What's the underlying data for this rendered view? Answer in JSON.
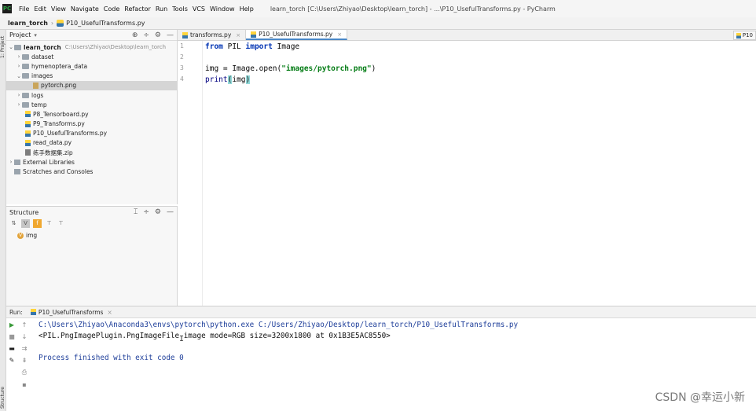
{
  "menubar": {
    "items": [
      "File",
      "Edit",
      "View",
      "Navigate",
      "Code",
      "Refactor",
      "Run",
      "Tools",
      "VCS",
      "Window",
      "Help"
    ],
    "window_title": "learn_torch [C:\\Users\\Zhiyao\\Desktop\\learn_torch] - ...\\P10_UsefulTransforms.py - PyCharm"
  },
  "navbar": {
    "project": "learn_torch",
    "file": "P10_UsefulTransforms.py"
  },
  "left_stripe": {
    "project_label": "1: Project",
    "structure_label": "Structure"
  },
  "project_panel": {
    "title": "Project",
    "tools": [
      "⊕",
      "÷",
      "⚙",
      "—"
    ],
    "tree": [
      {
        "label": "learn_torch",
        "hint": "C:\\Users\\Zhiyao\\Desktop\\learn_torch"
      },
      {
        "label": "dataset"
      },
      {
        "label": "hymenoptera_data"
      },
      {
        "label": "images"
      },
      {
        "label": "pytorch.png"
      },
      {
        "label": "logs"
      },
      {
        "label": "temp"
      },
      {
        "label": "P8_Tensorboard.py"
      },
      {
        "label": "P9_Transforms.py"
      },
      {
        "label": "P10_UsefulTransforms.py"
      },
      {
        "label": "read_data.py"
      },
      {
        "label": "练手数据集.zip"
      },
      {
        "label": "External Libraries"
      },
      {
        "label": "Scratches and Consoles"
      }
    ]
  },
  "structure_panel": {
    "title": "Structure",
    "item": "img"
  },
  "editor": {
    "tabs": [
      {
        "label": "transforms.py"
      },
      {
        "label": "P10_UsefulTransforms.py"
      }
    ],
    "right_tab": "P10",
    "line_numbers": [
      "1",
      "2",
      "3",
      "4"
    ],
    "code": {
      "l1_kw1": "from",
      "l1_mod": " PIL ",
      "l1_kw2": "import",
      "l1_name": " Image",
      "l3_pre": "img = Image.open(",
      "l3_str": "\"images/pytorch.png\"",
      "l3_post": ")",
      "l4_fn": "print",
      "l4_open": "(",
      "l4_arg": "img",
      "l4_close": ")"
    }
  },
  "run_panel": {
    "label": "Run:",
    "tab": "P10_UsefulTransforms",
    "output": [
      "C:\\Users\\Zhiyao\\Anaconda3\\envs\\pytorch\\python.exe C:/Users/Zhiyao/Desktop/learn_torch/P10_UsefulTransforms.py",
      "<PIL.PngImagePlugin.PngImageFile image mode=RGB size=3200x1800 at 0x1B3E5AC8550>",
      "Process finished with exit code 0"
    ]
  },
  "watermark": "CSDN @幸运小新",
  "colors": {
    "keyword": "#0033b3",
    "string": "#067d17",
    "console_path": "#1f3f9a",
    "selection": "#d5d5d5"
  }
}
